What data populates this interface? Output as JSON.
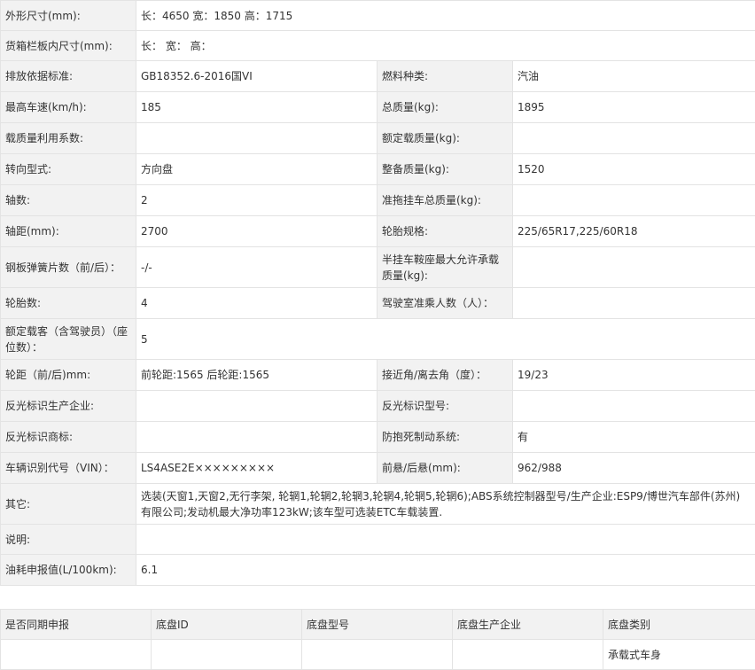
{
  "specs": {
    "dimensions": {
      "label": "外形尺寸(mm):",
      "value": "长：4650 宽：1850 高：1715"
    },
    "cargo_box": {
      "label": "货箱栏板内尺寸(mm):",
      "value": "长： 宽： 高："
    },
    "emission": {
      "label": "排放依据标准:",
      "value": "GB18352.6-2016国VI"
    },
    "fuel_type": {
      "label": "燃料种类:",
      "value": "汽油"
    },
    "max_speed": {
      "label": "最高车速(km/h):",
      "value": "185"
    },
    "total_mass": {
      "label": "总质量(kg):",
      "value": "1895"
    },
    "load_util": {
      "label": "载质量利用系数:",
      "value": ""
    },
    "rated_load": {
      "label": "额定载质量(kg):",
      "value": ""
    },
    "steering": {
      "label": "转向型式:",
      "value": "方向盘"
    },
    "curb_mass": {
      "label": "整备质量(kg):",
      "value": "1520"
    },
    "axles": {
      "label": "轴数:",
      "value": "2"
    },
    "trailer_mass": {
      "label": "准拖挂车总质量(kg):",
      "value": ""
    },
    "wheelbase": {
      "label": "轴距(mm):",
      "value": "2700"
    },
    "tire_spec": {
      "label": "轮胎规格:",
      "value": "225/65R17,225/60R18"
    },
    "leaf_springs": {
      "label": "钢板弹簧片数（前/后）：",
      "value": "-/-"
    },
    "fifth_wheel": {
      "label": "半挂车鞍座最大允许承载质量(kg):",
      "value": ""
    },
    "tire_count": {
      "label": "轮胎数:",
      "value": "4"
    },
    "cab_passengers": {
      "label": "驾驶室准乘人数（人）：",
      "value": ""
    },
    "rated_passengers": {
      "label": "额定载客（含驾驶员）（座位数）：",
      "value": "5"
    },
    "track": {
      "label": "轮距（前/后)mm:",
      "value": "前轮距:1565 后轮距:1565"
    },
    "angles": {
      "label": "接近角/离去角（度）：",
      "value": "19/23"
    },
    "reflector_maker": {
      "label": "反光标识生产企业:",
      "value": ""
    },
    "reflector_model": {
      "label": "反光标识型号:",
      "value": ""
    },
    "reflector_brand": {
      "label": "反光标识商标:",
      "value": ""
    },
    "abs": {
      "label": "防抱死制动系统:",
      "value": "有"
    },
    "vin": {
      "label": "车辆识别代号（VIN）：",
      "value": "LS4ASE2E×××××××××"
    },
    "overhang": {
      "label": "前悬/后悬(mm):",
      "value": "962/988"
    },
    "other": {
      "label": "其它:",
      "value": "选装(天窗1,天窗2,无行李架, 轮辋1,轮辋2,轮辋3,轮辋4,轮辋5,轮辋6);ABS系统控制器型号/生产企业:ESP9/博世汽车部件(苏州)有限公司;发动机最大净功率123kW;该车型可选装ETC车载装置."
    },
    "notes": {
      "label": "说明:",
      "value": ""
    },
    "fuel_consumption": {
      "label": "油耗申报值(L/100km):",
      "value": "6.1"
    }
  },
  "chassis": {
    "headers": [
      "是否同期申报",
      "底盘ID",
      "底盘型号",
      "底盘生产企业",
      "底盘类别"
    ],
    "row": [
      "",
      "",
      "",
      "",
      "承载式车身"
    ]
  }
}
